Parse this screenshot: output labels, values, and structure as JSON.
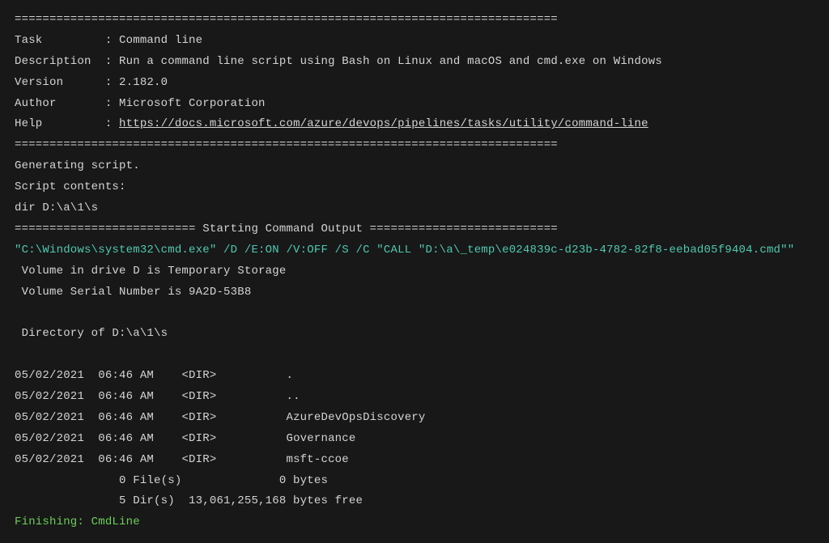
{
  "divider_long": "==============================================================================",
  "header": {
    "task_key": "Task",
    "task_val": "Command line",
    "desc_key": "Description",
    "desc_val": "Run a command line script using Bash on Linux and macOS and cmd.exe on Windows",
    "version_key": "Version",
    "version_val": "2.182.0",
    "author_key": "Author",
    "author_val": "Microsoft Corporation",
    "help_key": "Help",
    "help_url": "https://docs.microsoft.com/azure/devops/pipelines/tasks/utility/command-line"
  },
  "body": {
    "generating": "Generating script.",
    "script_contents_label": "Script contents:",
    "script_contents": "dir D:\\a\\1\\s",
    "starting_line": "========================== Starting Command Output ===========================",
    "cmd_line": "\"C:\\Windows\\system32\\cmd.exe\" /D /E:ON /V:OFF /S /C \"CALL \"D:\\a\\_temp\\e024839c-d23b-4782-82f8-eebad05f9404.cmd\"\"",
    "vol1": " Volume in drive D is Temporary Storage",
    "vol2": " Volume Serial Number is 9A2D-53B8",
    "dirof": " Directory of D:\\a\\1\\s",
    "entries": [
      {
        "date": "05/02/2021",
        "time": "06:46 AM",
        "type": "<DIR>",
        "name": "."
      },
      {
        "date": "05/02/2021",
        "time": "06:46 AM",
        "type": "<DIR>",
        "name": ".."
      },
      {
        "date": "05/02/2021",
        "time": "06:46 AM",
        "type": "<DIR>",
        "name": "AzureDevOpsDiscovery"
      },
      {
        "date": "05/02/2021",
        "time": "06:46 AM",
        "type": "<DIR>",
        "name": "Governance"
      },
      {
        "date": "05/02/2021",
        "time": "06:46 AM",
        "type": "<DIR>",
        "name": "msft-ccoe"
      }
    ],
    "summary1": "               0 File(s)              0 bytes",
    "summary2": "               5 Dir(s)  13,061,255,168 bytes free",
    "finishing": "Finishing: CmdLine"
  }
}
